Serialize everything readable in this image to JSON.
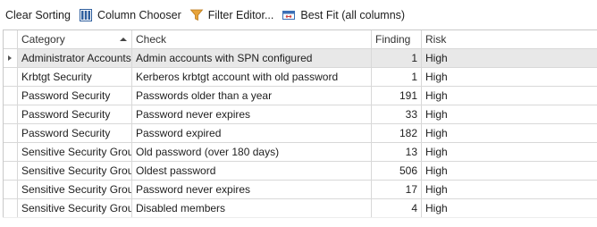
{
  "toolbar": {
    "clear_sorting": "Clear Sorting",
    "column_chooser": "Column Chooser",
    "filter_editor": "Filter Editor...",
    "best_fit": "Best Fit (all columns)"
  },
  "columns": {
    "category": "Category",
    "check": "Check",
    "finding": "Finding",
    "risk": "Risk"
  },
  "sort": {
    "column": "Category",
    "direction": "ascending"
  },
  "rows": [
    {
      "category": "Administrator Accounts",
      "check": "Admin accounts with SPN configured",
      "finding": "1",
      "risk": "High"
    },
    {
      "category": "Krbtgt Security",
      "check": "Kerberos krbtgt account with old password",
      "finding": "1",
      "risk": "High"
    },
    {
      "category": "Password Security",
      "check": "Passwords older than a year",
      "finding": "191",
      "risk": "High"
    },
    {
      "category": "Password Security",
      "check": "Password never expires",
      "finding": "33",
      "risk": "High"
    },
    {
      "category": "Password Security",
      "check": "Password expired",
      "finding": "182",
      "risk": "High"
    },
    {
      "category": "Sensitive Security Groups",
      "check": "Old password (over 180 days)",
      "finding": "13",
      "risk": "High"
    },
    {
      "category": "Sensitive Security Groups",
      "check": "Oldest password",
      "finding": "506",
      "risk": "High"
    },
    {
      "category": "Sensitive Security Groups",
      "check": "Password never expires",
      "finding": "17",
      "risk": "High"
    },
    {
      "category": "Sensitive Security Groups",
      "check": "Disabled members",
      "finding": "4",
      "risk": "High"
    }
  ],
  "selected_row": 0,
  "icons": {
    "column_chooser": "column-chooser-icon",
    "filter_editor": "funnel-icon",
    "best_fit": "best-fit-icon"
  },
  "colors": {
    "funnel": "#e8a43a",
    "column_chooser": "#2f5f9e",
    "best_fit": "#3b6fb6",
    "selected_row": "#e8e8e8"
  }
}
